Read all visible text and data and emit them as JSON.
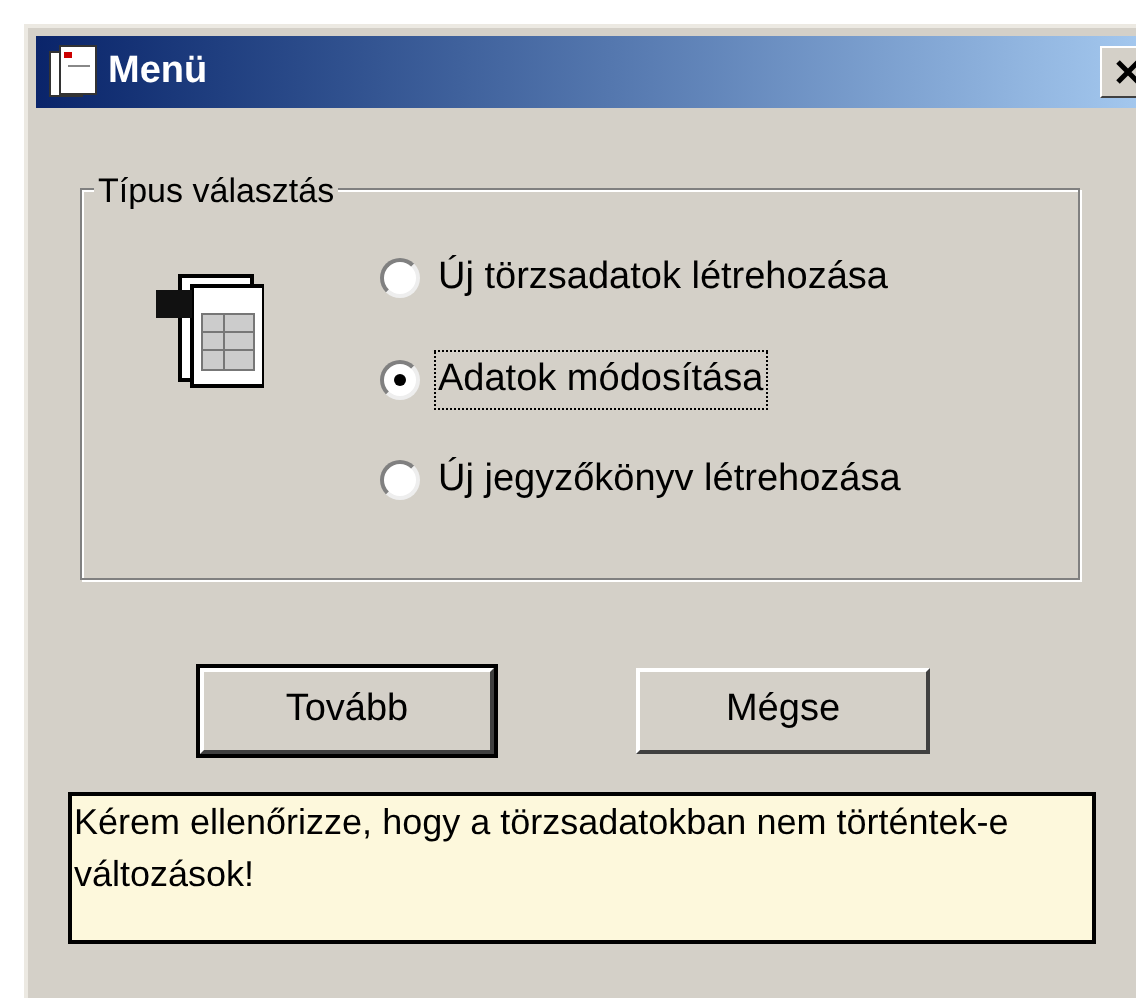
{
  "window": {
    "title": "Menü"
  },
  "group": {
    "legend": "Típus választás",
    "options": [
      {
        "label": "Új törzsadatok létrehozása",
        "selected": false,
        "focused": false
      },
      {
        "label": "Adatok módosítása",
        "selected": true,
        "focused": true
      },
      {
        "label": "Új jegyzőkönyv létrehozása",
        "selected": false,
        "focused": false
      }
    ]
  },
  "buttons": [
    {
      "label": "Tovább",
      "default": true
    },
    {
      "label": "Mégse",
      "default": false
    }
  ],
  "message": "Kérem ellenőrizze, hogy a törzsadatokban nem történtek-e változások!"
}
